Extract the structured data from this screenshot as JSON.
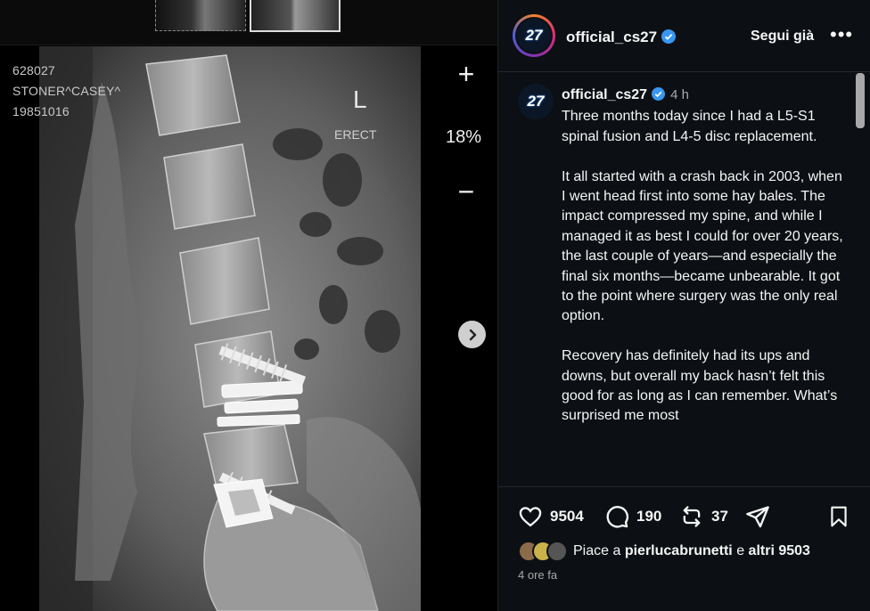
{
  "viewer": {
    "patient_id": "628027",
    "patient_name": "STONER^CASEY^",
    "patient_dob": "19851016",
    "side_marker": "L",
    "position_label": "ERECT",
    "zoom_level": "18%",
    "zoom_in": "+",
    "zoom_out": "−"
  },
  "post": {
    "username": "official_cs27",
    "avatar_text": "27",
    "follow_label": "Segui già",
    "more_label": "•••",
    "caption_time": "4 h",
    "caption_paragraphs": [
      "Three months today since I had a L5-S1 spinal fusion and L4-5 disc replacement.",
      "It all started with a crash back in 2003, when I went head first into some hay bales. The impact compressed my spine, and while I managed it as best I could for over 20 years, the last couple of years—and especially the final six months—became unbearable. It got to the point where surgery was the only real option.",
      "Recovery has definitely had its ups and downs, but overall my back hasn’t felt this good for as long as I can remember. What’s surprised me most"
    ],
    "like_count": "9504",
    "comment_count": "190",
    "repost_count": "37",
    "likes_prefix": "Piace a",
    "likes_user": "pierlucabrunetti",
    "likes_connector": "e",
    "likes_others": "altri 9503",
    "timestamp": "4 ore fa"
  },
  "colors": {
    "verified": "#3897f0",
    "background": "#0c1014",
    "muted": "#a8a8a8"
  }
}
